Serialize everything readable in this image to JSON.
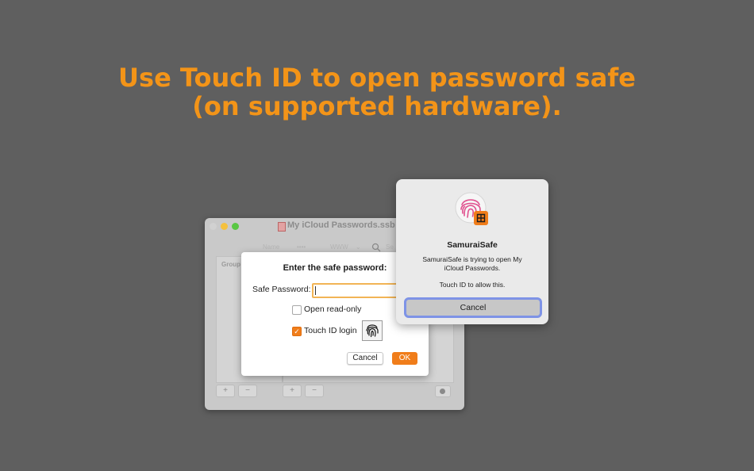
{
  "headline": {
    "line1": "Use Touch ID to open password safe",
    "line2": "(on supported hardware)."
  },
  "main_window": {
    "title": "My iCloud Passwords.ssb",
    "toolbar": {
      "name_col": "Name",
      "dots": "••••",
      "www": "WWW",
      "search_stub": "Se"
    },
    "sidebar_header": "Group",
    "add_label": "+",
    "remove_label": "−"
  },
  "password_sheet": {
    "title": "Enter the safe password:",
    "password_label": "Safe Password:",
    "password_value": "",
    "open_readonly_label": "Open read-only",
    "open_readonly_checked": false,
    "touchid_label": "Touch ID login",
    "touchid_checked": true,
    "cancel_label": "Cancel",
    "ok_label": "OK"
  },
  "touchid_dialog": {
    "app_name": "SamuraiSafe",
    "message": "SamuraiSafe is trying to open My iCloud Passwords.",
    "instruction": "Touch ID to allow this.",
    "cancel_label": "Cancel"
  },
  "colors": {
    "accent": "#f07d1a",
    "headline": "#f39418",
    "focus_ring": "#7e93e6",
    "background": "#5f5f5f"
  },
  "icons": {
    "touchid": "fingerprint-icon",
    "app": "samuraisafe-app-icon"
  }
}
